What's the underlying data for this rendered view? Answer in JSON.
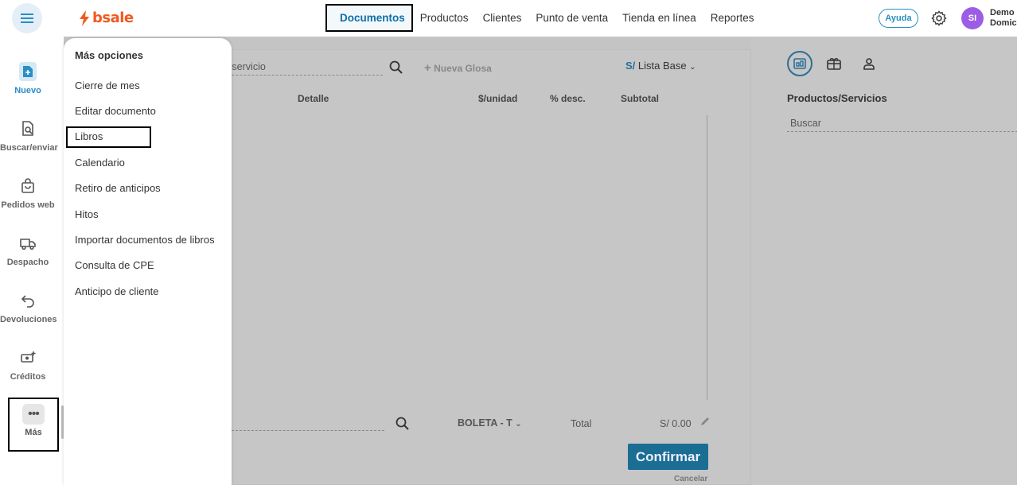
{
  "brand": {
    "name": "bsale",
    "color": "#f05a22"
  },
  "accent_color": "#2a8ec4",
  "nav": {
    "items": [
      {
        "label": "Documentos",
        "active": true
      },
      {
        "label": "Productos"
      },
      {
        "label": "Clientes"
      },
      {
        "label": "Punto de venta"
      },
      {
        "label": "Tienda en línea"
      },
      {
        "label": "Reportes"
      }
    ]
  },
  "header": {
    "help_label": "Ayuda",
    "avatar_initials": "SI",
    "user_name_line1": "Demo",
    "user_name_line2": "Domic",
    "icons": [
      "menu-icon",
      "gear-icon"
    ]
  },
  "sidebar": {
    "items": [
      {
        "label": "Nuevo",
        "icon": "new-document-icon",
        "active": true
      },
      {
        "label": "Buscar/enviar",
        "icon": "document-search-icon"
      },
      {
        "label": "Pedidos web",
        "icon": "shopping-bag-icon"
      },
      {
        "label": "Despacho",
        "icon": "truck-icon"
      },
      {
        "label": "Devoluciones",
        "icon": "return-arrow-icon"
      },
      {
        "label": "Créditos",
        "icon": "money-plus-icon"
      },
      {
        "label": "Más",
        "icon": "more-dots-icon"
      }
    ]
  },
  "more_menu": {
    "title": "Más opciones",
    "items": [
      "Cierre de mes",
      "Editar documento",
      "Libros",
      "Calendario",
      "Retiro de anticipos",
      "Hitos",
      "Importar documentos de libros",
      "Consulta de CPE",
      "Anticipo de cliente"
    ]
  },
  "document": {
    "product_search_placeholder": "o servicio",
    "new_gloss_label": "Nueva Glosa",
    "currency_symbol": "S/",
    "price_list": "Lista Base",
    "columns": [
      "Detalle",
      "$/unidad",
      "% desc.",
      "Subtotal"
    ],
    "doc_type": "BOLETA - T",
    "total_label": "Total",
    "total_value": "S/ 0.00",
    "confirm_label": "Confirmar",
    "cancel_label": "Cancelar"
  },
  "right_panel": {
    "title": "Productos/Servicios",
    "search_placeholder": "Buscar",
    "icons": [
      "pos-terminal-icon",
      "gift-card-icon",
      "person-icon"
    ]
  }
}
